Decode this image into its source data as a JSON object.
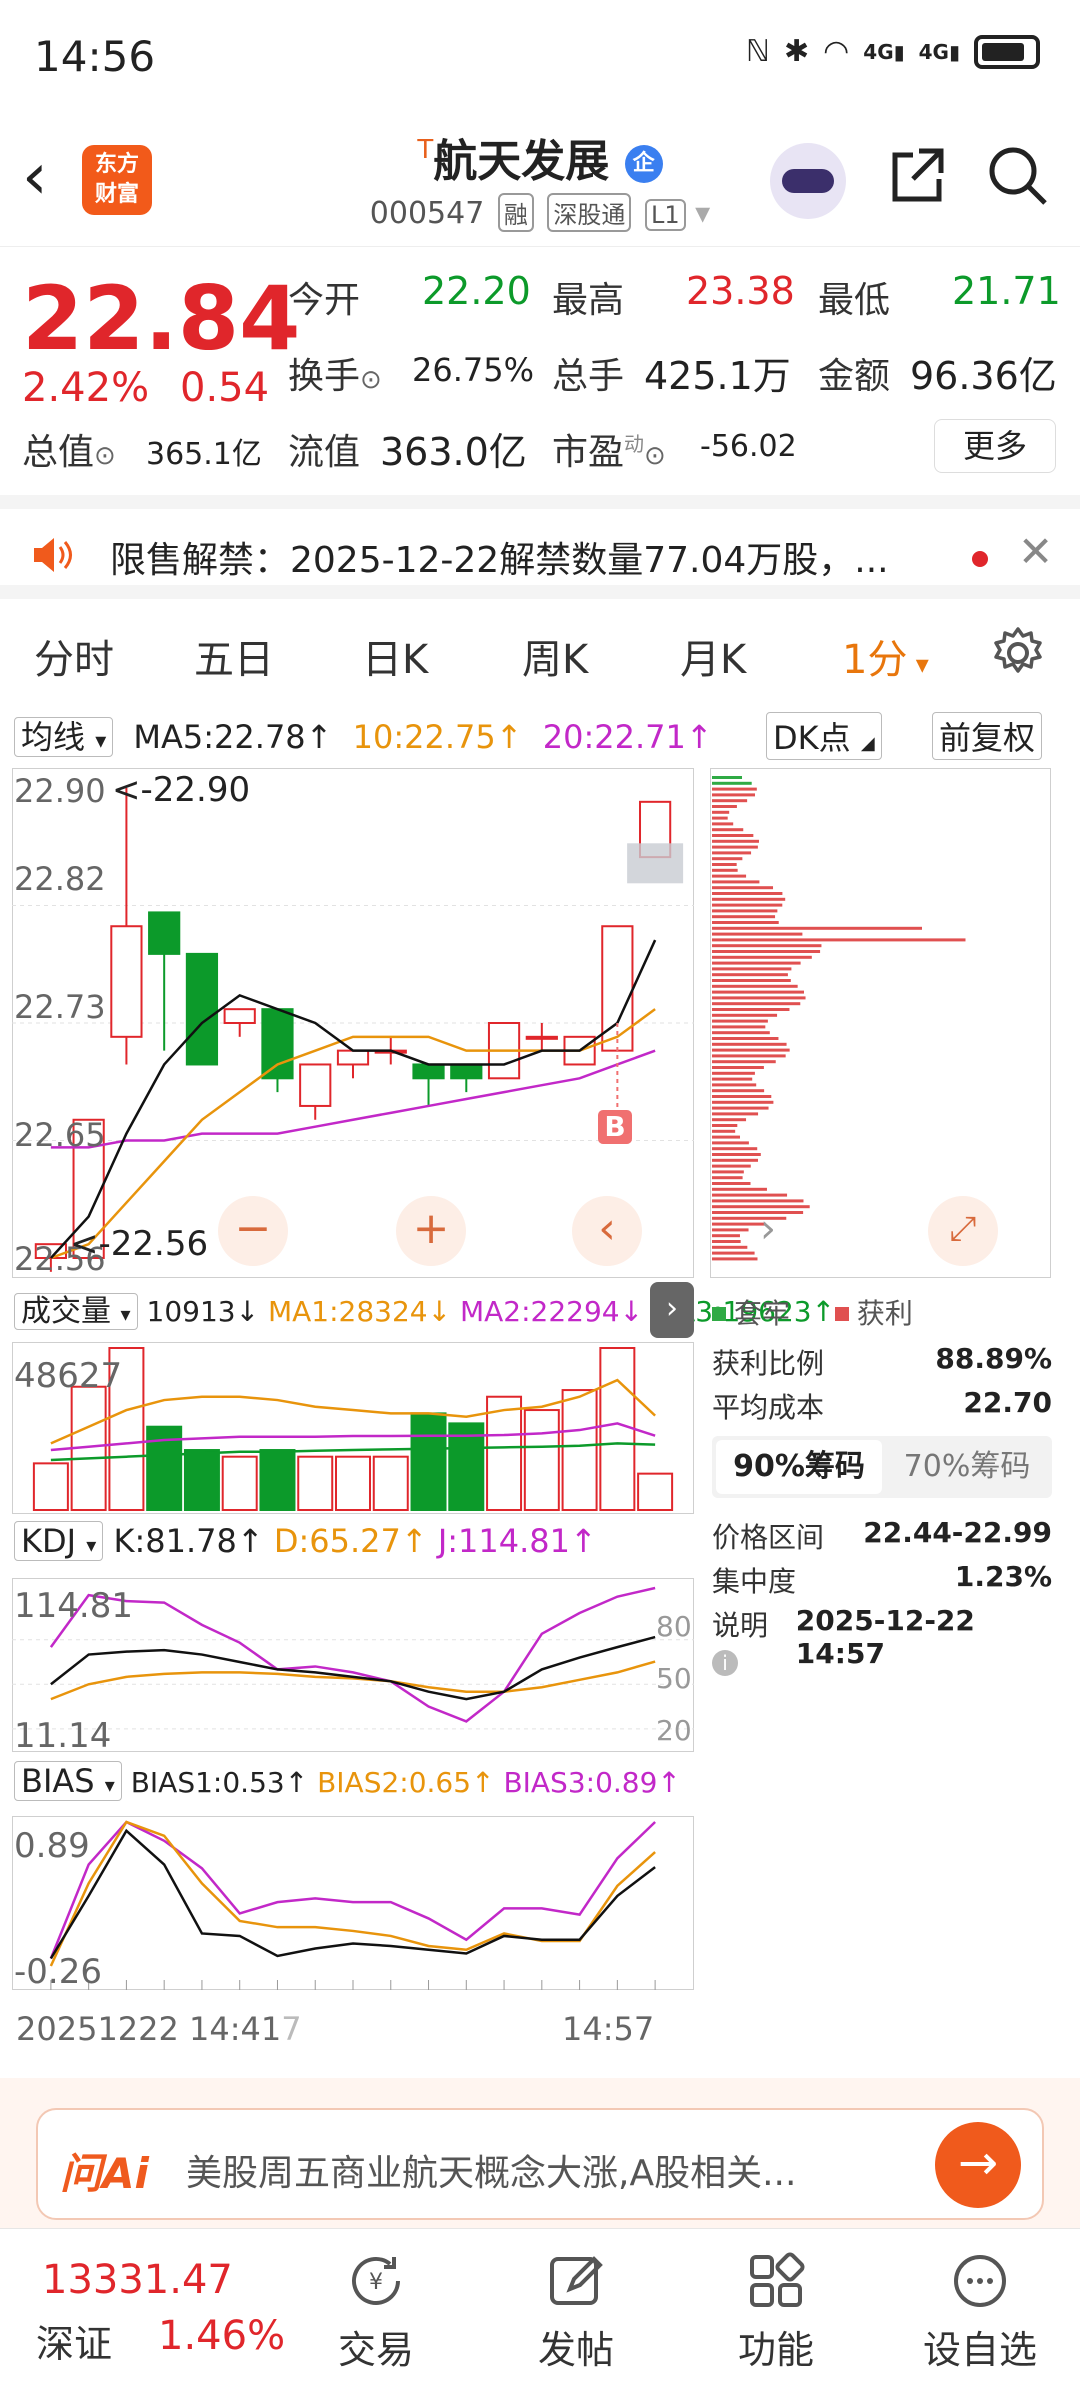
{
  "status": {
    "time": "14:56",
    "icons": [
      "nfc-icon",
      "bluetooth-icon",
      "wifi-icon",
      "signal-4g-icon",
      "signal-4g-icon",
      "battery-icon"
    ],
    "net1": "4G",
    "net2": "4G"
  },
  "header": {
    "back": "‹",
    "logo": "东方\n财富",
    "logo_line1": "东方",
    "logo_line2": "财富",
    "title_prefix": "T",
    "title": "航天发展",
    "badge": "企",
    "code": "000547",
    "tags": [
      "融",
      "深股通",
      "L1"
    ]
  },
  "quote": {
    "price": "22.84",
    "pct": "2.42%",
    "chg": "0.54",
    "open_label": "今开",
    "open": "22.20",
    "high_label": "最高",
    "high": "23.38",
    "low_label": "最低",
    "low": "21.71",
    "turnover_label": "换手",
    "turnover": "26.75%",
    "volume_label": "总手",
    "volume": "425.1万",
    "amount_label": "金额",
    "amount": "96.36亿",
    "mktcap_label": "总值",
    "mktcap": "365.1亿",
    "float_label": "流值",
    "float": "363.0亿",
    "pe_label": "市盈",
    "pe_sup": "动",
    "pe": "-56.02",
    "more": "更多"
  },
  "notice": {
    "text": "限售解禁：2025-12-22解禁数量77.04万股，..."
  },
  "tabs": [
    "分时",
    "五日",
    "日K",
    "周K",
    "月K",
    "1分"
  ],
  "ma_bar": {
    "selector": "均线",
    "ma5": "MA5:22.78↑",
    "ma10": "10:22.75↑",
    "ma20": "20:22.71↑",
    "dk": "DK点",
    "fq": "前复权"
  },
  "main_axis": {
    "labels": [
      "22.90",
      "22.82",
      "22.73",
      "22.65",
      "22.56"
    ],
    "max_mark": "<-22.90",
    "min_mark": "<-22.56",
    "b_mark": "B"
  },
  "vol_bar": {
    "selector": "成交量",
    "v": "10913↓",
    "ma1": "MA1:28324↓",
    "ma2": "MA2:22294↓",
    "ma3": "MA3:19623↑",
    "axis_max": "48627"
  },
  "kdj_bar": {
    "selector": "KDJ",
    "k": "K:81.78↑",
    "d": "D:65.27↑",
    "j": "J:114.81↑",
    "axis_top": "114.81",
    "axis_bottom": "11.14",
    "lv80": "80",
    "lv50": "50",
    "lv20": "20"
  },
  "bias_bar": {
    "selector": "BIAS",
    "b1": "BIAS1:0.53↑",
    "b2": "BIAS2:0.65↑",
    "b3": "BIAS3:0.89↑",
    "axis_top": "0.89",
    "axis_bottom": "-0.26"
  },
  "time_axis": {
    "start": "20251222 14:41",
    "start_sep": "7",
    "end": "14:57"
  },
  "chip": {
    "legend_trapped": "套牢",
    "legend_profit": "获利",
    "profit_ratio_label": "获利比例",
    "profit_ratio": "88.89%",
    "avg_cost_label": "平均成本",
    "avg_cost": "22.70",
    "tab90": "90%筹码",
    "tab70": "70%筹码",
    "range_label": "价格区间",
    "range": "22.44-22.99",
    "concentration_label": "集中度",
    "concentration": "1.23%",
    "note_label": "说明",
    "note_time": "2025-12-22 14:57"
  },
  "ai": {
    "brand": "问Ai",
    "query": "美股周五商业航天概念大涨,A股相关..."
  },
  "bottom": {
    "index_value": "13331.47",
    "index_name": "深证",
    "index_pct": "1.46%",
    "items": [
      "交易",
      "发帖",
      "功能",
      "设自选"
    ]
  },
  "colors": {
    "up": "#e0262b",
    "down": "#0c9a2a",
    "accent": "#e8760c",
    "ma10": "#e8940c",
    "ma20": "#c228c8"
  },
  "chart_data": {
    "type": "candlestick",
    "candles": [
      {
        "o": 22.56,
        "h": 22.57,
        "l": 22.55,
        "c": 22.57
      },
      {
        "o": 22.56,
        "h": 22.66,
        "l": 22.56,
        "c": 22.66
      },
      {
        "o": 22.72,
        "h": 22.9,
        "l": 22.7,
        "c": 22.8
      },
      {
        "o": 22.81,
        "h": 22.81,
        "l": 22.71,
        "c": 22.78
      },
      {
        "o": 22.78,
        "h": 22.78,
        "l": 22.7,
        "c": 22.7
      },
      {
        "o": 22.73,
        "h": 22.74,
        "l": 22.72,
        "c": 22.74
      },
      {
        "o": 22.74,
        "h": 22.74,
        "l": 22.68,
        "c": 22.69
      },
      {
        "o": 22.67,
        "h": 22.7,
        "l": 22.66,
        "c": 22.7
      },
      {
        "o": 22.7,
        "h": 22.71,
        "l": 22.69,
        "c": 22.71
      },
      {
        "o": 22.71,
        "h": 22.72,
        "l": 22.7,
        "c": 22.71
      },
      {
        "o": 22.7,
        "h": 22.7,
        "l": 22.67,
        "c": 22.69
      },
      {
        "o": 22.7,
        "h": 22.7,
        "l": 22.68,
        "c": 22.69
      },
      {
        "o": 22.69,
        "h": 22.73,
        "l": 22.69,
        "c": 22.73
      },
      {
        "o": 22.72,
        "h": 22.73,
        "l": 22.71,
        "c": 22.72
      },
      {
        "o": 22.7,
        "h": 22.72,
        "l": 22.7,
        "c": 22.72
      },
      {
        "o": 22.71,
        "h": 22.8,
        "l": 22.71,
        "c": 22.8
      },
      {
        "o": 22.85,
        "h": 22.89,
        "l": 22.85,
        "c": 22.89
      }
    ],
    "ma5": [
      22.56,
      22.59,
      22.65,
      22.7,
      22.73,
      22.75,
      22.74,
      22.73,
      22.71,
      22.71,
      22.7,
      22.7,
      22.7,
      22.71,
      22.71,
      22.73,
      22.79
    ],
    "ma10": [
      22.56,
      22.57,
      22.6,
      22.63,
      22.66,
      22.68,
      22.7,
      22.71,
      22.72,
      22.72,
      22.72,
      22.71,
      22.71,
      22.71,
      22.71,
      22.72,
      22.74
    ],
    "ma20": [
      22.64,
      22.64,
      22.645,
      22.645,
      22.65,
      22.65,
      22.65,
      22.655,
      22.66,
      22.665,
      22.67,
      22.675,
      22.68,
      22.685,
      22.69,
      22.7,
      22.71
    ],
    "volume": [
      14000,
      37000,
      48627,
      25000,
      18000,
      16000,
      18000,
      16000,
      16000,
      16000,
      29000,
      26000,
      34000,
      30000,
      36000,
      48627,
      10913
    ],
    "vol_ma1": [
      20000,
      25000,
      30000,
      33000,
      34000,
      34000,
      33000,
      31000,
      30000,
      29000,
      29000,
      28000,
      30000,
      31000,
      34000,
      39000,
      28324
    ],
    "vol_ma2": [
      18000,
      19000,
      20000,
      21000,
      21500,
      22000,
      22000,
      22000,
      22200,
      22200,
      22300,
      22300,
      22500,
      23000,
      24000,
      26000,
      22294
    ],
    "vol_ma3": [
      15000,
      15500,
      16000,
      16500,
      17000,
      17500,
      17500,
      17800,
      18000,
      18200,
      18400,
      18600,
      18800,
      19000,
      19300,
      20000,
      19623
    ],
    "k": [
      50,
      70,
      72,
      73,
      70,
      65,
      60,
      58,
      55,
      52,
      45,
      40,
      45,
      60,
      68,
      75,
      81.78
    ],
    "d": [
      40,
      50,
      55,
      57,
      58,
      58,
      57,
      55,
      54,
      52,
      48,
      45,
      45,
      48,
      53,
      58,
      65.27
    ],
    "j": [
      75,
      110,
      106,
      105,
      90,
      78,
      60,
      62,
      58,
      52,
      35,
      25,
      45,
      84,
      98,
      109,
      114.81
    ],
    "bias1": [
      -0.2,
      0.3,
      0.82,
      0.55,
      0.0,
      -0.02,
      -0.18,
      -0.12,
      -0.08,
      -0.1,
      -0.13,
      -0.16,
      -0.02,
      -0.05,
      -0.05,
      0.3,
      0.53
    ],
    "bias2": [
      -0.26,
      0.4,
      0.89,
      0.78,
      0.4,
      0.1,
      0.05,
      0.05,
      0.02,
      -0.02,
      -0.1,
      -0.13,
      0.0,
      -0.06,
      -0.06,
      0.38,
      0.65
    ],
    "bias3": [
      -0.2,
      0.55,
      0.89,
      0.74,
      0.52,
      0.16,
      0.25,
      0.28,
      0.25,
      0.25,
      0.12,
      -0.05,
      0.2,
      0.2,
      0.15,
      0.6,
      0.89
    ],
    "price_range": [
      22.56,
      22.9
    ]
  }
}
